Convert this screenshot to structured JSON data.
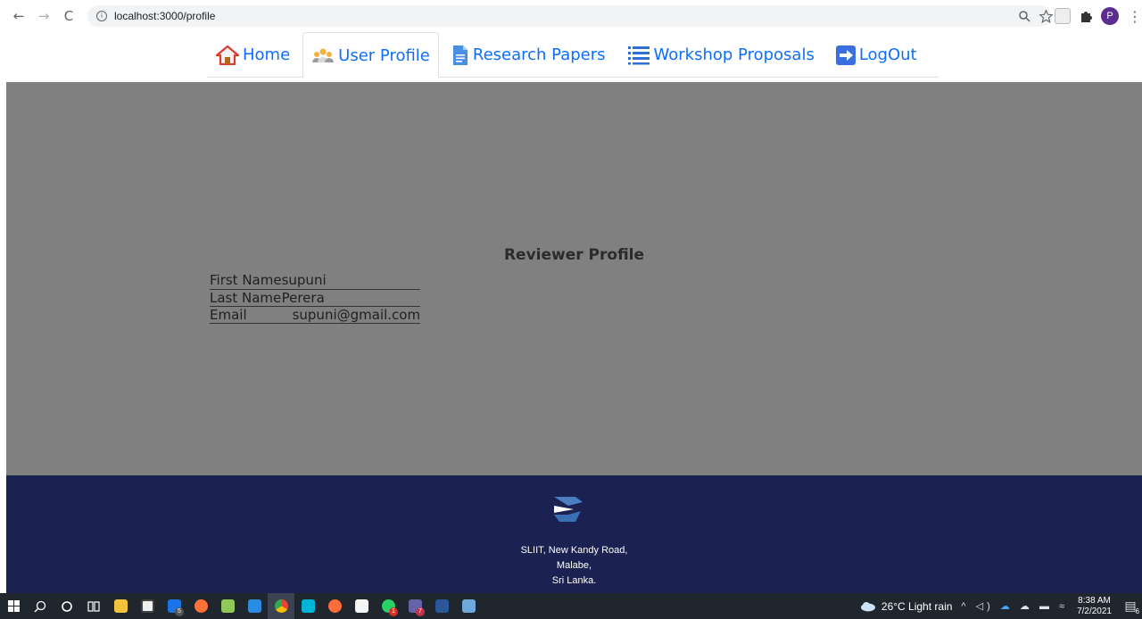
{
  "browser": {
    "back_icon": "←",
    "forward_icon": "→",
    "reload_icon": "C",
    "info_icon": "i",
    "url": "localhost:3000/profile",
    "profile_initial": "P"
  },
  "nav": {
    "items": [
      {
        "label": "Home",
        "icon": "home-icon",
        "active": false
      },
      {
        "label": "User Profile",
        "icon": "users-icon",
        "active": true
      },
      {
        "label": "Research Papers",
        "icon": "document-icon",
        "active": false
      },
      {
        "label": "Workshop Proposals",
        "icon": "list-icon",
        "active": false
      },
      {
        "label": "LogOut",
        "icon": "logout-arrow-icon",
        "active": false
      }
    ]
  },
  "profile": {
    "title": "Reviewer Profile",
    "fields": [
      {
        "label": "First Name",
        "value": "supuni"
      },
      {
        "label": "Last Name",
        "value": "Perera"
      },
      {
        "label": "Email",
        "value": "supuni@gmail.com"
      }
    ]
  },
  "footer": {
    "address_line1": "SLIIT, New Kandy Road,",
    "address_line2": "Malabe,",
    "address_line3": "Sri Lanka."
  },
  "taskbar": {
    "weather": "26°C  Light rain",
    "time": "8:38 AM",
    "date": "7/2/2021",
    "mail_badge": "5",
    "notification_count": "6",
    "whatsapp_badge": "1",
    "teams_badge": "7"
  },
  "colors": {
    "nav_link": "#0d6efd",
    "main_bg": "#808080",
    "footer_bg": "#1b2150",
    "taskbar_bg": "#20262e"
  }
}
